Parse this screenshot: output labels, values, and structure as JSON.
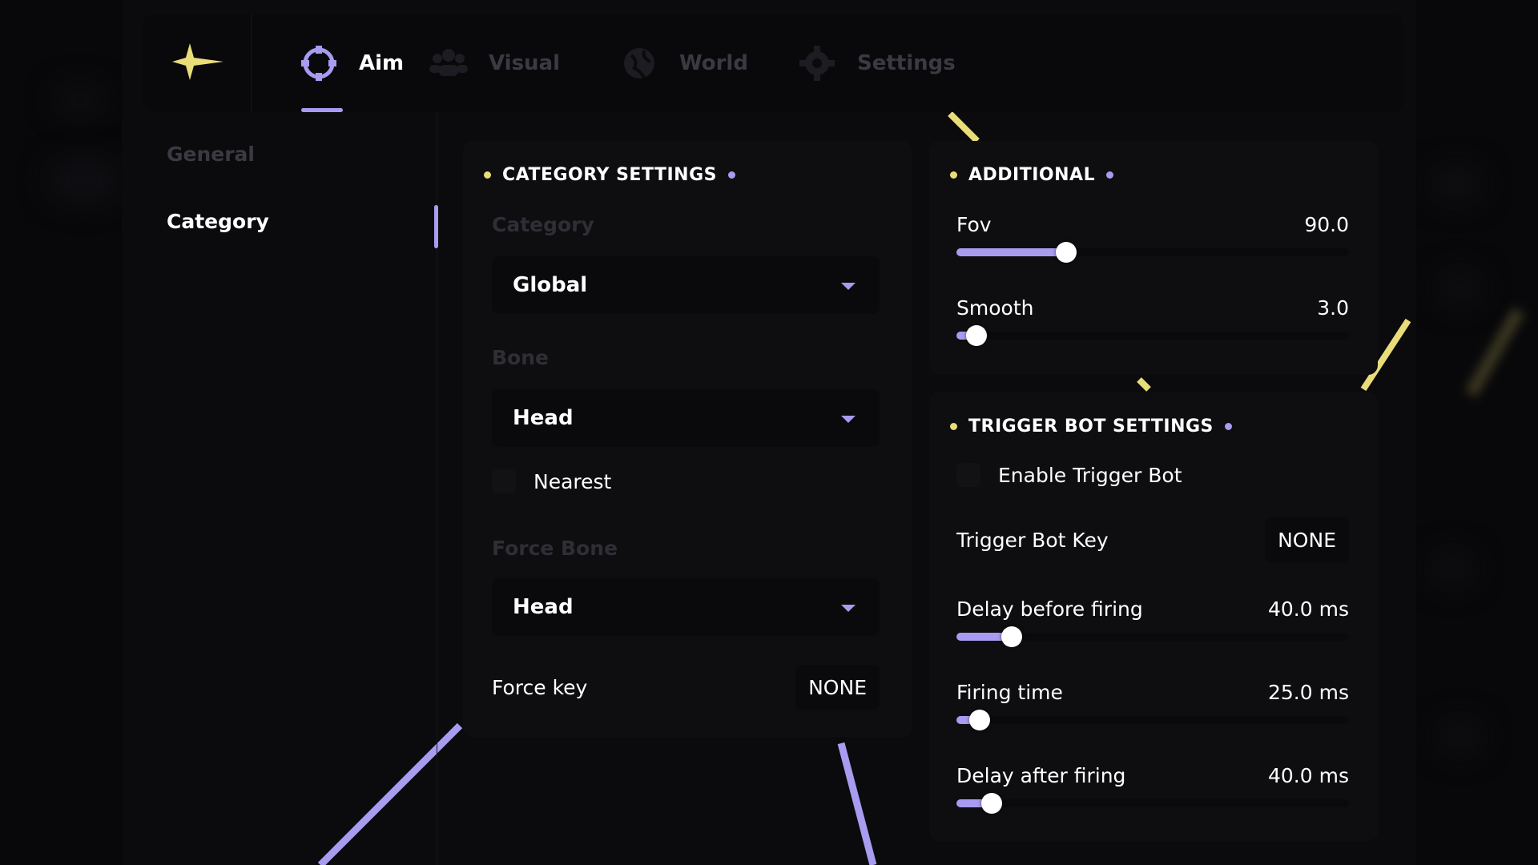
{
  "colors": {
    "accent": "#a79cf0",
    "highlight": "#e9dd7a",
    "background": "#0b0b0d"
  },
  "logo_icon": "four-point-star-icon",
  "tabs": [
    {
      "label": "Aim",
      "icon": "crosshair-icon",
      "active": true
    },
    {
      "label": "Visual",
      "icon": "users-icon",
      "active": false
    },
    {
      "label": "World",
      "icon": "globe-icon",
      "active": false
    },
    {
      "label": "Settings",
      "icon": "gear-icon",
      "active": false
    }
  ],
  "sidebar": {
    "items": [
      {
        "label": "General",
        "active": false
      },
      {
        "label": "Category",
        "active": true
      }
    ]
  },
  "category_settings": {
    "title": "CATEGORY SETTINGS",
    "category_label": "Category",
    "category_value": "Global",
    "bone_label": "Bone",
    "bone_value": "Head",
    "nearest_label": "Nearest",
    "nearest_checked": false,
    "force_bone_label": "Force Bone",
    "force_bone_value": "Head",
    "force_key_label": "Force key",
    "force_key_value": "NONE"
  },
  "additional": {
    "title": "ADDITIONAL",
    "sliders": [
      {
        "label": "Fov",
        "value": "90.0",
        "fill_fraction": 0.28
      },
      {
        "label": "Smooth",
        "value": "3.0",
        "fill_fraction": 0.05
      }
    ]
  },
  "trigger_bot": {
    "title": "TRIGGER BOT SETTINGS",
    "enable_label": "Enable Trigger Bot",
    "enable_checked": false,
    "key_label": "Trigger Bot Key",
    "key_value": "NONE",
    "sliders": [
      {
        "label": "Delay before firing",
        "value": "40.0 ms",
        "fill_fraction": 0.14
      },
      {
        "label": "Firing time",
        "value": "25.0 ms",
        "fill_fraction": 0.06
      },
      {
        "label": "Delay after firing",
        "value": "40.0 ms",
        "fill_fraction": 0.09
      }
    ]
  }
}
